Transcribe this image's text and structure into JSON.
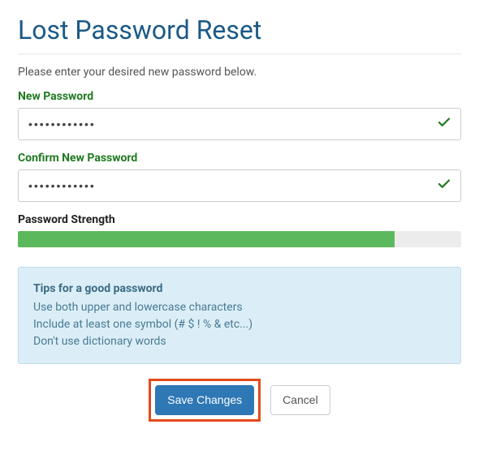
{
  "title": "Lost Password Reset",
  "subtitle": "Please enter your desired new password below.",
  "form": {
    "new_password": {
      "label": "New Password",
      "value": "••••••••••••",
      "valid": true
    },
    "confirm_password": {
      "label": "Confirm New Password",
      "value": "••••••••••••",
      "valid": true
    }
  },
  "strength": {
    "label": "Password Strength",
    "percent": 85,
    "color": "#5cb85c"
  },
  "tips": {
    "title": "Tips for a good password",
    "lines": [
      "Use both upper and lowercase characters",
      "Include at least one symbol (# $ ! % & etc...)",
      "Don't use dictionary words"
    ]
  },
  "actions": {
    "save": "Save Changes",
    "cancel": "Cancel"
  }
}
